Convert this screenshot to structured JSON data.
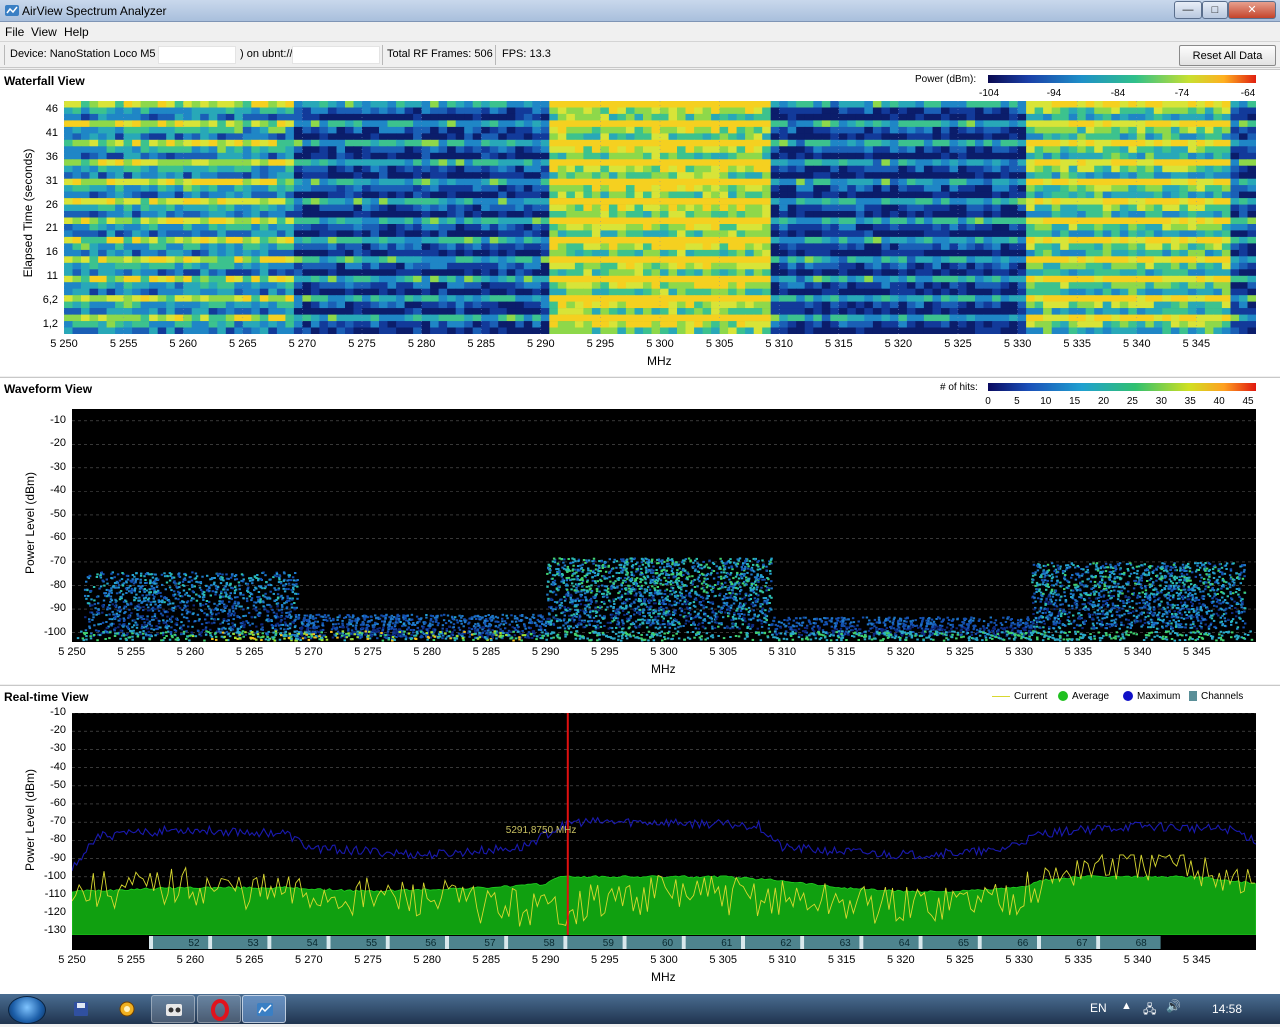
{
  "window": {
    "title": "AirView Spectrum Analyzer",
    "minimize": "—",
    "maximize": "□",
    "close": "✕"
  },
  "menu": [
    "File",
    "View",
    "Help"
  ],
  "info": {
    "device_label": "Device: NanoStation Loco M5 (",
    "device_mid": ") on ubnt://",
    "frames": "Total RF Frames: 506",
    "fps": "FPS: 13.3",
    "reset_button": "Reset All Data"
  },
  "waterfall": {
    "title": "Waterfall View",
    "ylabel": "Elapsed Time (seconds)",
    "xlabel": "MHz",
    "yticks": [
      "46",
      "41",
      "36",
      "31",
      "26",
      "21",
      "16",
      "11",
      "6,2",
      "1,2"
    ],
    "xticks": [
      "5 250",
      "5 255",
      "5 260",
      "5 265",
      "5 270",
      "5 275",
      "5 280",
      "5 285",
      "5 290",
      "5 295",
      "5 300",
      "5 305",
      "5 310",
      "5 315",
      "5 320",
      "5 325",
      "5 330",
      "5 335",
      "5 340",
      "5 345"
    ],
    "colorbar_label": "Power (dBm):",
    "colorbar_ticks": [
      "-104",
      "-94",
      "-84",
      "-74",
      "-64"
    ]
  },
  "waveform": {
    "title": "Waveform View",
    "ylabel": "Power Level (dBm)",
    "xlabel": "MHz",
    "yticks": [
      "-10",
      "-20",
      "-30",
      "-40",
      "-50",
      "-60",
      "-70",
      "-80",
      "-90",
      "-100"
    ],
    "xticks": [
      "5 250",
      "5 255",
      "5 260",
      "5 265",
      "5 270",
      "5 275",
      "5 280",
      "5 285",
      "5 290",
      "5 295",
      "5 300",
      "5 305",
      "5 310",
      "5 315",
      "5 320",
      "5 325",
      "5 330",
      "5 335",
      "5 340",
      "5 345"
    ],
    "colorbar_label": "# of hits:",
    "colorbar_ticks": [
      "0",
      "5",
      "10",
      "15",
      "20",
      "25",
      "30",
      "35",
      "40",
      "45"
    ]
  },
  "realtime": {
    "title": "Real-time View",
    "ylabel": "Power Level (dBm)",
    "xlabel": "MHz",
    "yticks": [
      "-10",
      "-20",
      "-30",
      "-40",
      "-50",
      "-60",
      "-70",
      "-80",
      "-90",
      "-100",
      "-110",
      "-120",
      "-130"
    ],
    "xticks": [
      "5 250",
      "5 255",
      "5 260",
      "5 265",
      "5 270",
      "5 275",
      "5 280",
      "5 285",
      "5 290",
      "5 295",
      "5 300",
      "5 305",
      "5 310",
      "5 315",
      "5 320",
      "5 325",
      "5 330",
      "5 335",
      "5 340",
      "5 345"
    ],
    "legend": [
      "Current",
      "Average",
      "Maximum",
      "Channels"
    ],
    "cursor_label": "5291,8750 MHz",
    "cursor_mhz": 5291.875,
    "channels": [
      "52",
      "53",
      "54",
      "55",
      "56",
      "57",
      "58",
      "59",
      "60",
      "61",
      "62",
      "63",
      "64",
      "65",
      "66",
      "67",
      "68"
    ]
  },
  "chart_data": {
    "type": "line",
    "x_range": [
      5250,
      5350
    ],
    "ylim": [
      -130,
      -10
    ],
    "xlabel": "MHz",
    "ylabel": "Power Level (dBm)",
    "series": [
      {
        "name": "Average",
        "x": [
          5250,
          5259,
          5268,
          5275,
          5285,
          5290,
          5291,
          5295,
          5300,
          5305,
          5310,
          5315,
          5320,
          5325,
          5330,
          5332,
          5335,
          5340,
          5345,
          5350
        ],
        "values": [
          -108,
          -106,
          -106,
          -108,
          -106,
          -104,
          -100,
          -100,
          -100,
          -100,
          -102,
          -106,
          -108,
          -108,
          -106,
          -102,
          -100,
          -100,
          -100,
          -104
        ]
      },
      {
        "name": "Maximum",
        "x": [
          5250,
          5252,
          5259,
          5268,
          5270,
          5280,
          5288,
          5292,
          5300,
          5308,
          5310,
          5320,
          5328,
          5332,
          5340,
          5348,
          5350
        ],
        "values": [
          -96,
          -78,
          -74,
          -76,
          -84,
          -88,
          -84,
          -70,
          -70,
          -72,
          -84,
          -88,
          -86,
          -76,
          -72,
          -74,
          -80
        ]
      },
      {
        "name": "Current",
        "x": [
          5250,
          5260,
          5270,
          5280,
          5290,
          5300,
          5310,
          5320,
          5330,
          5335,
          5340,
          5345,
          5350
        ],
        "values": [
          -108,
          -105,
          -110,
          -112,
          -118,
          -108,
          -112,
          -116,
          -110,
          -95,
          -92,
          -94,
          -105
        ]
      }
    ]
  },
  "taskbar": {
    "lang": "EN",
    "clock": "14:58"
  }
}
